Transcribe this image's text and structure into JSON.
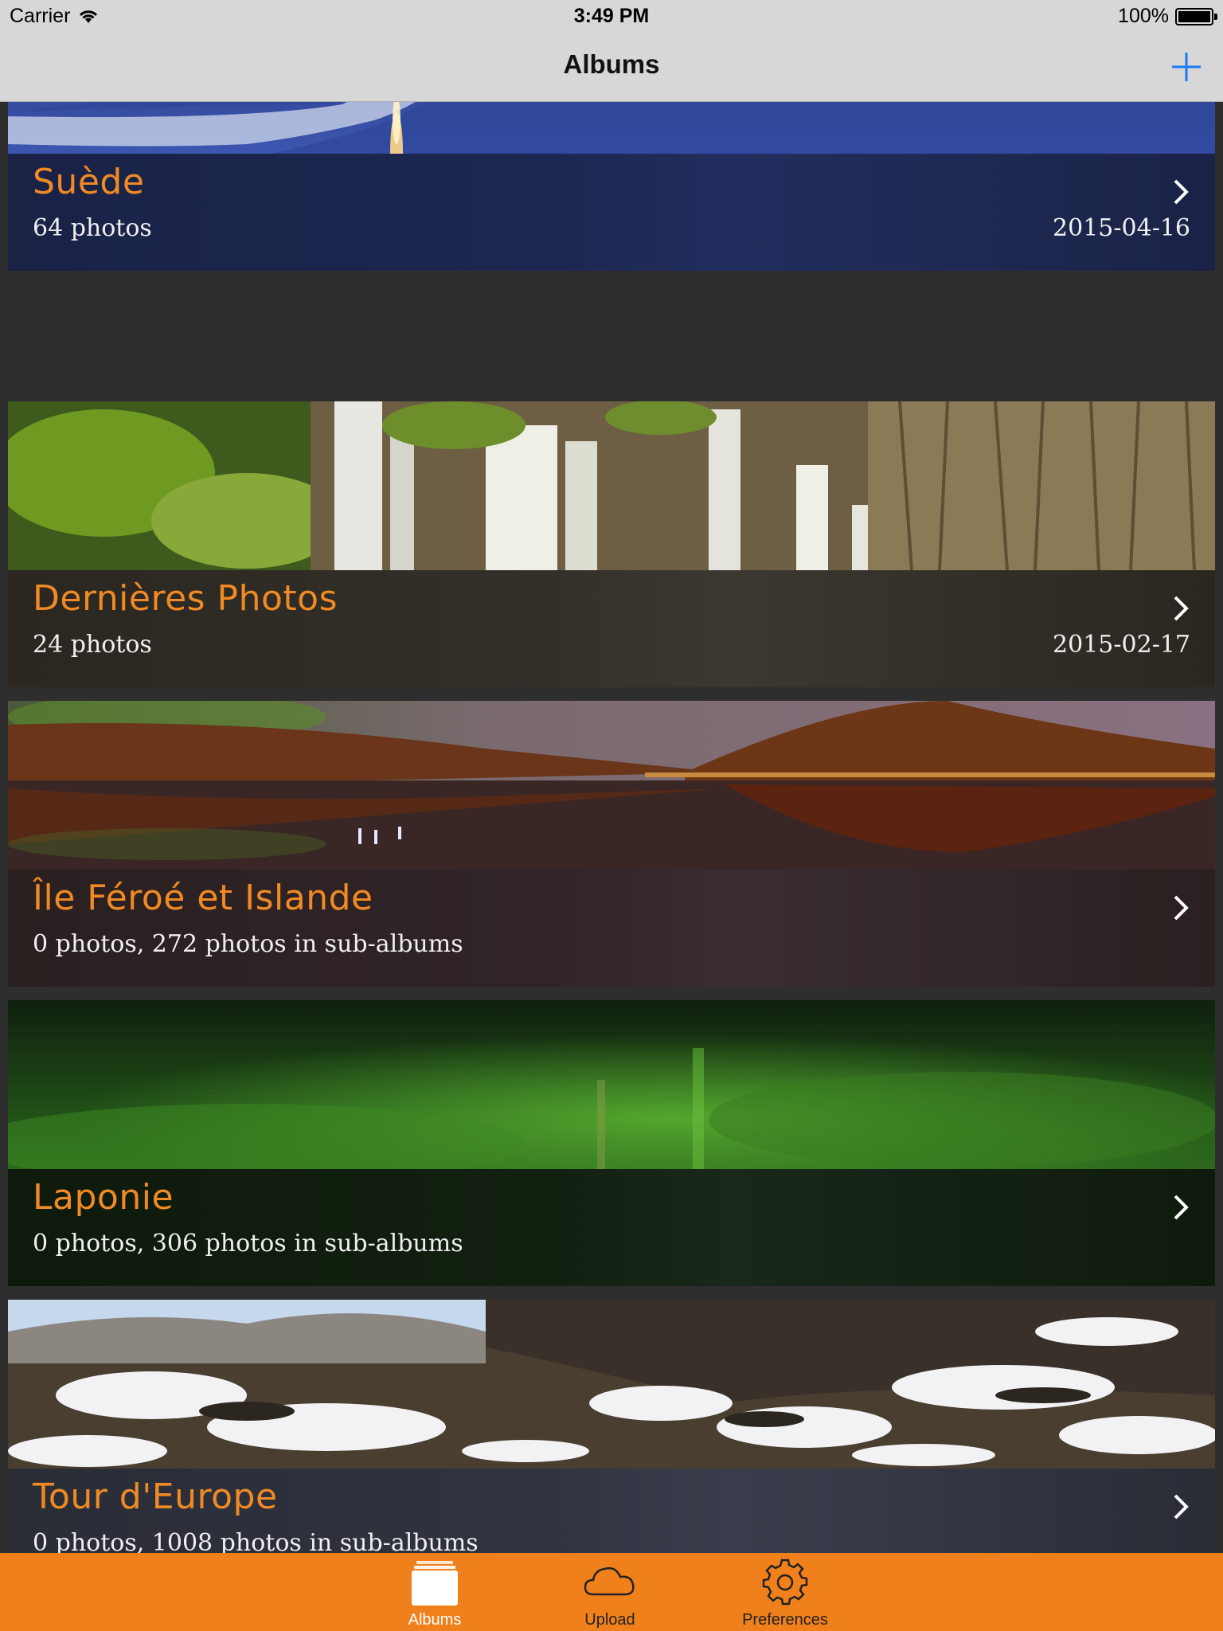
{
  "status_bar": {
    "carrier": "Carrier",
    "time": "3:49 PM",
    "battery": "100%"
  },
  "nav": {
    "title": "Albums",
    "add_icon": "plus-icon"
  },
  "albums": [
    {
      "name": "Suède",
      "count": "64 photos",
      "date": "2015-04-16"
    },
    {
      "name": "Dernières Photos",
      "count": "24 photos",
      "date": "2015-02-17"
    },
    {
      "name": "Île Féroé et Islande",
      "count": "0 photos, 272 photos in sub-albums",
      "date": ""
    },
    {
      "name": "Laponie",
      "count": "0 photos, 306 photos in sub-albums",
      "date": ""
    },
    {
      "name": "Tour d'Europe",
      "count": "0 photos, 1008 photos in sub-albums",
      "date": ""
    }
  ],
  "tabs": [
    {
      "label": "Albums",
      "icon": "albums-icon",
      "active": true
    },
    {
      "label": "Upload",
      "icon": "cloud-icon",
      "active": false
    },
    {
      "label": "Preferences",
      "icon": "gear-icon",
      "active": false
    }
  ],
  "colors": {
    "accent": "#f08a24",
    "tab_bar": "#f0801c",
    "nav_add": "#1a7cf5"
  }
}
